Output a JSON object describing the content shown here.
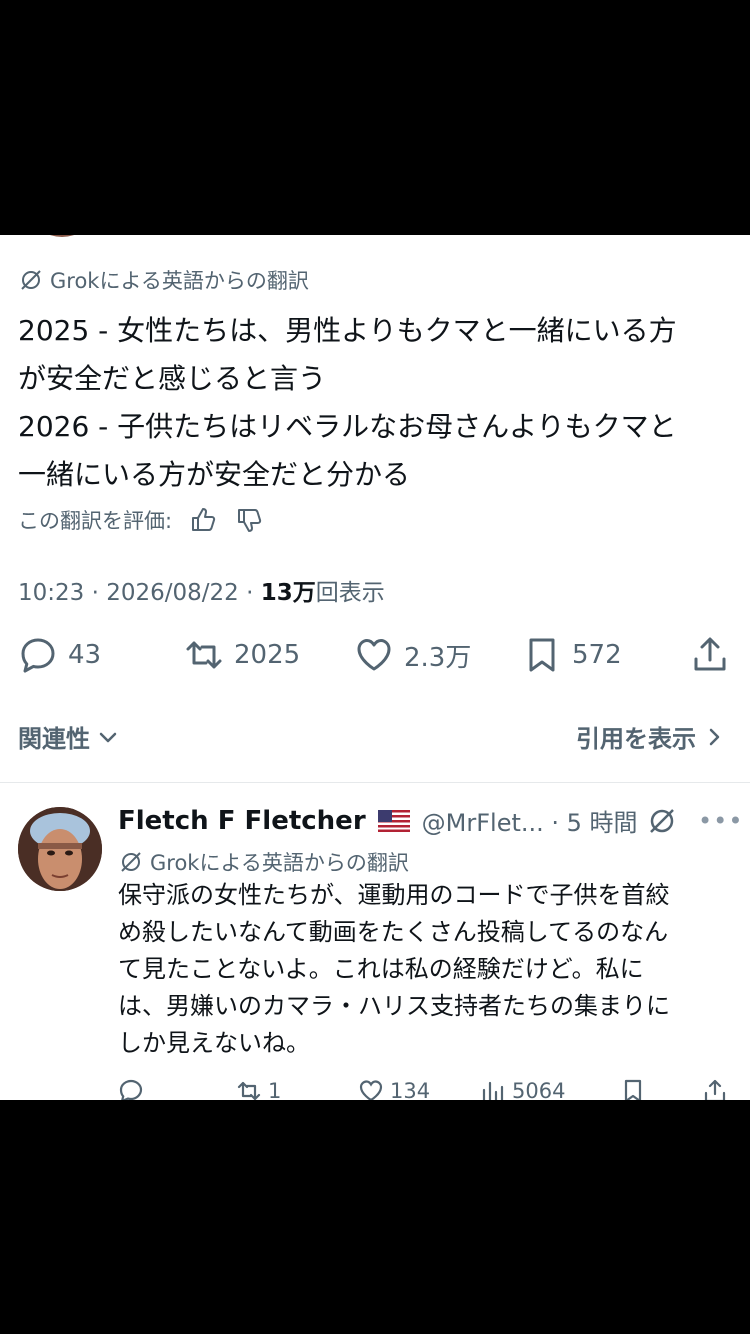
{
  "translation_label": "Grokによる英語からの翻訳",
  "tweet": {
    "lines": [
      "2025 - 女性たちは、男性よりもクマと一緒にいる方",
      "が安全だと感じると言う",
      "2026 - 子供たちはリベラルなお母さんよりもクマと",
      "一緒にいる方が安全だと分かる"
    ],
    "rate_label": "この翻訳を評価:",
    "timestamp": "10:23 · 2026/08/22 · ",
    "views_count": "13万",
    "views_label": "回表示",
    "actions": {
      "replies": "43",
      "reposts": "2025",
      "likes": "2.3万",
      "bookmarks": "572"
    }
  },
  "related_label": "関連性",
  "quotes_label": "引用を表示",
  "reply": {
    "name": "Fletch F Fletcher",
    "handle": "@MrFlet... · 5 時間",
    "translation_label": "Grokによる英語からの翻訳",
    "lines": [
      "保守派の女性たちが、運動用のコードで子供を首絞",
      "め殺したいなんて動画をたくさん投稿してるのなん",
      "て見たことないよ。これは私の経験だけど。私に",
      "は、男嫌いのカマラ・ハリス支持者たちの集まりに",
      "しか見えないね。"
    ],
    "actions": {
      "reposts": "1",
      "likes": "134",
      "views": "5064"
    }
  },
  "colors": {
    "text": "#0f1419",
    "secondary": "#536471",
    "background": "#ffffff"
  },
  "icons": [
    "grok-icon",
    "thumbs-up-icon",
    "thumbs-down-icon",
    "reply-icon",
    "repost-icon",
    "like-icon",
    "bookmark-icon",
    "share-icon",
    "chevron-down-icon",
    "chevron-right-icon",
    "flag-icon",
    "more-icon",
    "views-icon"
  ]
}
